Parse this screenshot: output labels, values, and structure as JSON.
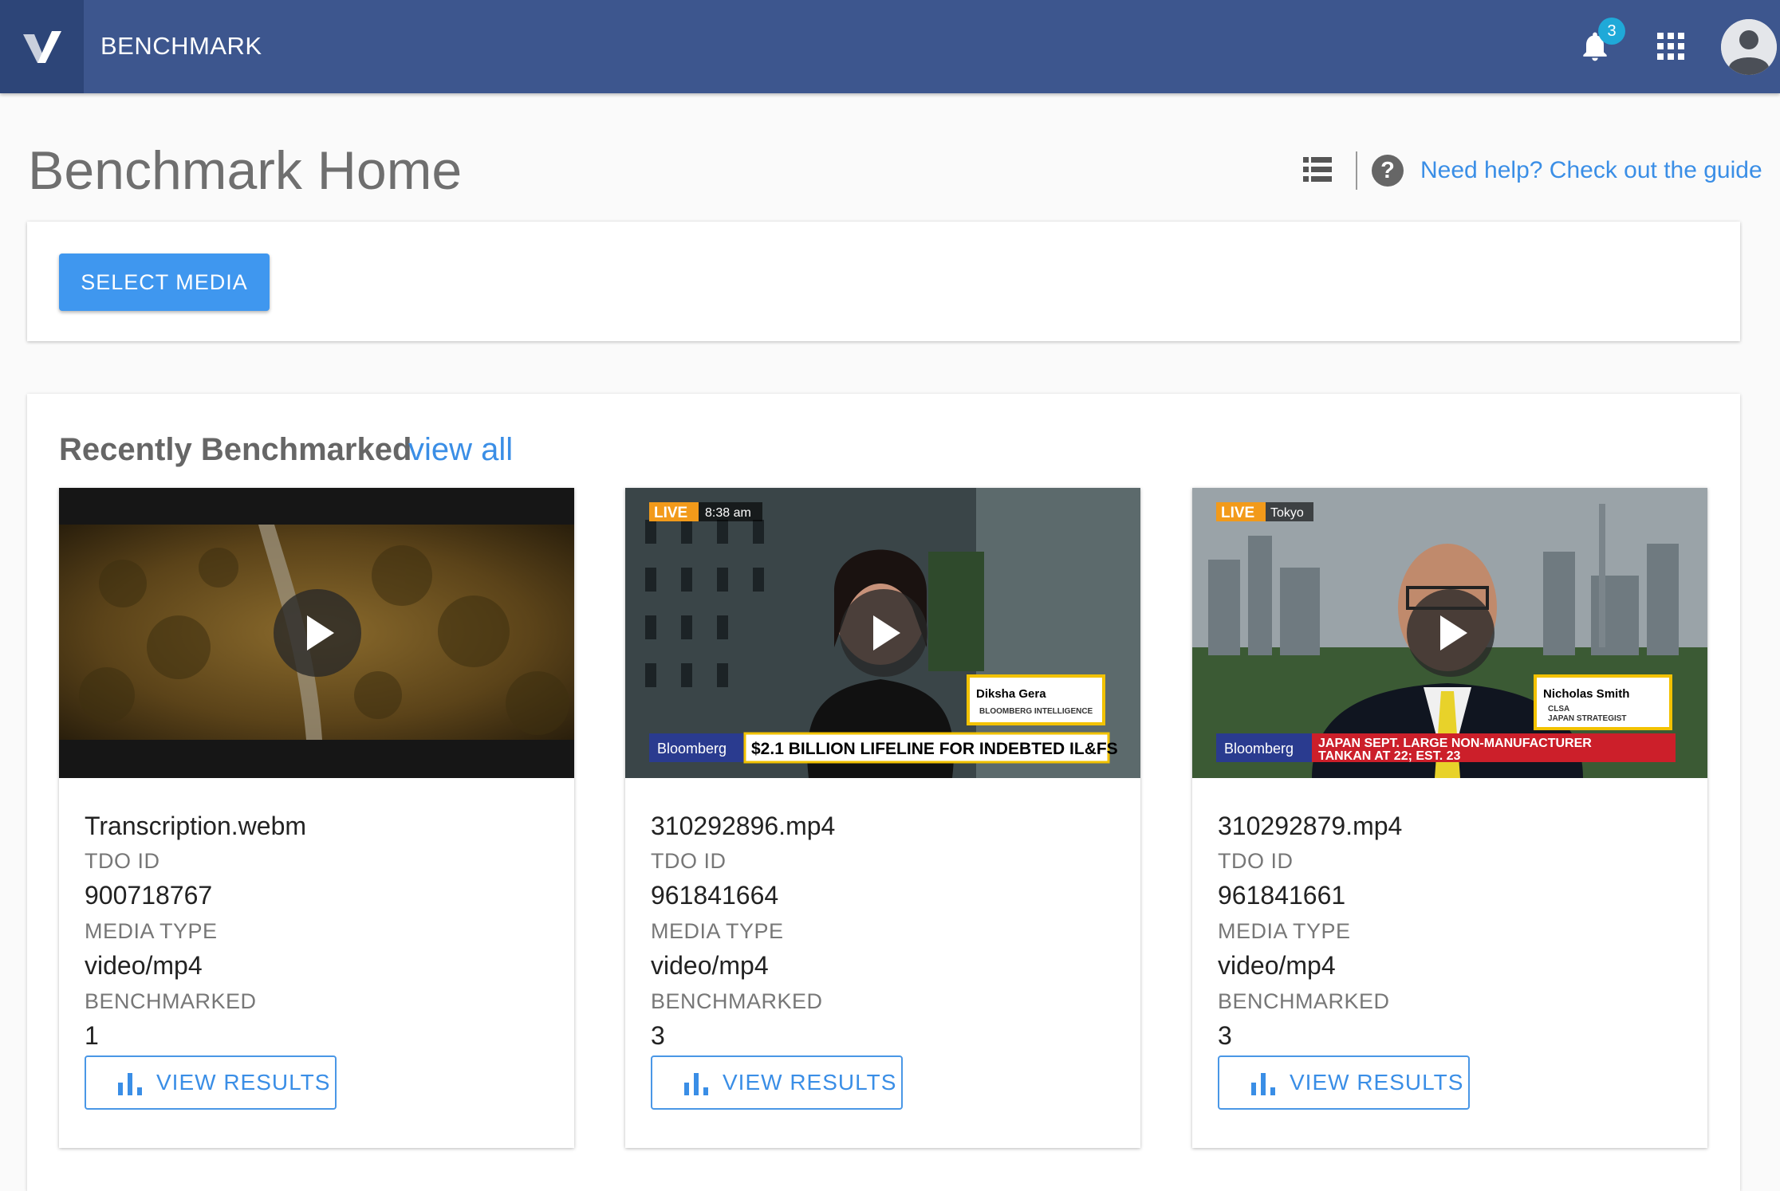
{
  "app": {
    "name": "BENCHMARK",
    "notification_count": "3"
  },
  "header": {
    "title": "Benchmark Home",
    "help_link": "Need help? Check out the guide",
    "help_icon_glyph": "?"
  },
  "select_media": {
    "label": "SELECT MEDIA"
  },
  "recent": {
    "title": "Recently Benchmarked",
    "view_all": "view all",
    "items": [
      {
        "file_name": "Transcription.webm",
        "tdo_id_label": "TDO ID",
        "tdo_id": "900718767",
        "media_type_label": "MEDIA TYPE",
        "media_type": "video/mp4",
        "benchmarked_label": "BENCHMARKED",
        "benchmarked": "1",
        "button_label": "VIEW RESULTS"
      },
      {
        "file_name": "310292896.mp4",
        "tdo_id_label": "TDO ID",
        "tdo_id": "961841664",
        "media_type_label": "MEDIA TYPE",
        "media_type": "video/mp4",
        "benchmarked_label": "BENCHMARKED",
        "benchmarked": "3",
        "button_label": "VIEW RESULTS",
        "overlay": {
          "live": "LIVE",
          "time": "8:38 am",
          "brand": "Bloomberg",
          "headline": "$2.1 BILLION LIFELINE FOR INDEBTED IL&FS",
          "name": "Diksha Gera",
          "role": "BLOOMBERG INTELLIGENCE"
        }
      },
      {
        "file_name": "310292879.mp4",
        "tdo_id_label": "TDO ID",
        "tdo_id": "961841661",
        "media_type_label": "MEDIA TYPE",
        "media_type": "video/mp4",
        "benchmarked_label": "BENCHMARKED",
        "benchmarked": "3",
        "button_label": "VIEW RESULTS",
        "overlay": {
          "live": "LIVE",
          "time": "Tokyo",
          "brand": "Bloomberg",
          "headline1": "JAPAN SEPT. LARGE NON-MANUFACTURER",
          "headline2": "TANKAN AT 22; EST. 23",
          "name": "Nicholas Smith",
          "role1": "CLSA",
          "role2": "JAPAN STRATEGIST"
        }
      }
    ]
  },
  "icons": {
    "logo": "veritone-logo-icon",
    "bell": "bell-icon",
    "apps": "apps-grid-icon",
    "avatar": "account-circle-icon",
    "list": "list-view-icon",
    "help": "help-circle-icon",
    "play": "play-icon",
    "bar_chart": "bar-chart-icon"
  },
  "colors": {
    "topbar": "#3d568e",
    "logo_box": "#2d4578",
    "primary_button": "#3f97ef",
    "link": "#3a8ee6",
    "badge": "#1fa9d8"
  }
}
